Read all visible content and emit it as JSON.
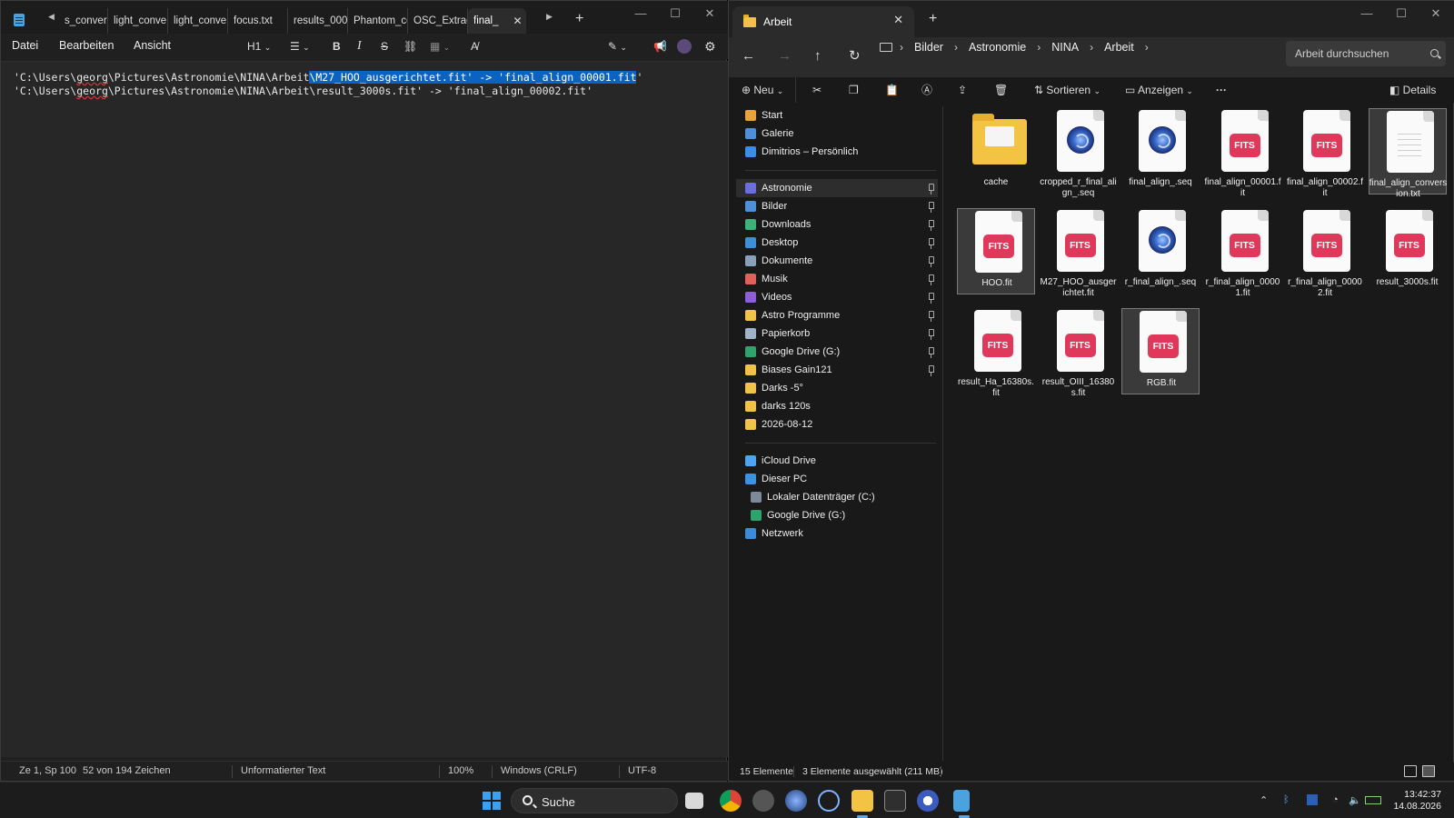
{
  "notepad": {
    "tabs": [
      "s_conver",
      "light_conve",
      "light_conve",
      "focus.txt",
      "results_000(",
      "Phantom_cc",
      "OSC_Extract"
    ],
    "active_tab": "final_",
    "menu": [
      "Datei",
      "Bearbeiten",
      "Ansicht"
    ],
    "heading_select": "H1",
    "lines": [
      {
        "pre": "'C:\\Users\\",
        "squiggle": "georg",
        "mid": "\\Pictures\\Astronomie\\NINA\\Arbeit",
        "selected": "\\M27_HOO_ausgerichtet.fit' -> 'final_align_00001.fit",
        "post": "'"
      },
      {
        "pre": "'C:\\Users\\",
        "squiggle": "georg",
        "mid": "\\Pictures\\Astronomie\\NINA\\Arbeit\\result_3000s.fit' -> 'final_align_00002.fit'",
        "selected": "",
        "post": ""
      }
    ],
    "status": {
      "position": "Ze 1, Sp 100",
      "chars": "52 von 194 Zeichen",
      "format": "Unformatierter Text",
      "zoom": "100%",
      "line_ending": "Windows (CRLF)",
      "encoding": "UTF-8"
    }
  },
  "explorer": {
    "tab_title": "Arbeit",
    "breadcrumbs": [
      "Bilder",
      "Astronomie",
      "NINA",
      "Arbeit"
    ],
    "search_placeholder": "Arbeit durchsuchen",
    "toolbar": {
      "new": "Neu",
      "sort": "Sortieren",
      "view": "Anzeigen",
      "more": "···",
      "details": "Details"
    },
    "sidebar": {
      "top": [
        {
          "label": "Start",
          "icon": "home-icon"
        },
        {
          "label": "Galerie",
          "icon": "gallery-icon"
        },
        {
          "label": "Dimitrios – Persönlich",
          "icon": "onedrive-icon"
        }
      ],
      "pinned": [
        {
          "label": "Astronomie",
          "icon": "astronomie-icon"
        },
        {
          "label": "Bilder",
          "icon": "pictures-icon"
        },
        {
          "label": "Downloads",
          "icon": "downloads-icon"
        },
        {
          "label": "Desktop",
          "icon": "desktop-icon"
        },
        {
          "label": "Dokumente",
          "icon": "documents-icon"
        },
        {
          "label": "Musik",
          "icon": "music-icon"
        },
        {
          "label": "Videos",
          "icon": "videos-icon"
        },
        {
          "label": "Astro Programme",
          "icon": "folder-icon"
        },
        {
          "label": "Papierkorb",
          "icon": "recycle-bin-icon"
        },
        {
          "label": "Google Drive (G:)",
          "icon": "google-drive-icon"
        },
        {
          "label": "Biases Gain121",
          "icon": "folder-icon"
        },
        {
          "label": "Darks -5°",
          "icon": "folder-icon"
        },
        {
          "label": "darks 120s",
          "icon": "folder-icon"
        },
        {
          "label": "2026-08-12",
          "icon": "folder-icon"
        }
      ],
      "bottom": [
        {
          "label": "iCloud Drive",
          "icon": "icloud-icon"
        },
        {
          "label": "Dieser PC",
          "icon": "pc-icon"
        },
        {
          "label": "Lokaler Datenträger (C:)",
          "icon": "drive-icon"
        },
        {
          "label": "Google Drive (G:)",
          "icon": "google-drive-icon"
        },
        {
          "label": "Netzwerk",
          "icon": "network-icon"
        }
      ]
    },
    "files": [
      {
        "name": "cache",
        "type": "folder",
        "selected": false
      },
      {
        "name": "cropped_r_final_align_.seq",
        "type": "seq",
        "selected": false
      },
      {
        "name": "final_align_.seq",
        "type": "seq",
        "selected": false
      },
      {
        "name": "final_align_00001.fit",
        "type": "fits",
        "selected": false
      },
      {
        "name": "final_align_00002.fit",
        "type": "fits",
        "selected": false
      },
      {
        "name": "final_align_conversion.txt",
        "type": "txt",
        "selected": true
      },
      {
        "name": "HOO.fit",
        "type": "fits",
        "selected": true
      },
      {
        "name": "M27_HOO_ausgerichtet.fit",
        "type": "fits",
        "selected": false
      },
      {
        "name": "r_final_align_.seq",
        "type": "seq",
        "selected": false
      },
      {
        "name": "r_final_align_00001.fit",
        "type": "fits",
        "selected": false
      },
      {
        "name": "r_final_align_00002.fit",
        "type": "fits",
        "selected": false
      },
      {
        "name": "result_3000s.fit",
        "type": "fits",
        "selected": false
      },
      {
        "name": "result_Ha_16380s.fit",
        "type": "fits",
        "selected": false
      },
      {
        "name": "result_OIII_16380s.fit",
        "type": "fits",
        "selected": false
      },
      {
        "name": "RGB.fit",
        "type": "fits",
        "selected": true
      }
    ],
    "fits_label": "FITS",
    "status": {
      "count": "15 Elemente",
      "selection": "3 Elemente ausgewählt (211 MB)"
    }
  },
  "taskbar": {
    "search": "Suche",
    "time": "13:42:37",
    "date": "14.08.2026"
  },
  "colors": {
    "selection": "#0b63c1",
    "fits_badge": "#e0385a",
    "folder": "#f3c443",
    "accent": "#3aa0f3"
  }
}
